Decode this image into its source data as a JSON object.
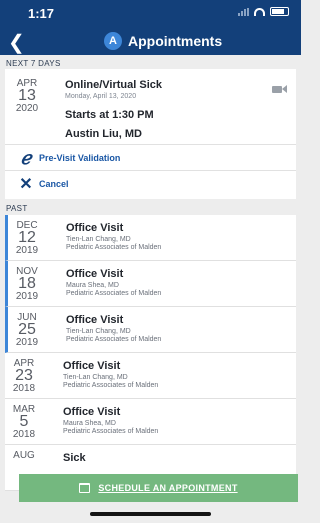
{
  "status_bar": {
    "time": "1:17"
  },
  "header": {
    "avatar_letter": "A",
    "title": "Appointments"
  },
  "sections": {
    "next_label": "NEXT 7 DAYS",
    "past_label": "PAST"
  },
  "upcoming": {
    "month": "APR",
    "day": "13",
    "year": "2020",
    "title": "Online/Virtual Sick",
    "subtitle": "Monday, April 13, 2020",
    "time": "Starts at 1:30 PM",
    "doctor": "Austin Liu, MD",
    "previsit_label": "Pre-Visit Validation",
    "cancel_label": "Cancel"
  },
  "past": [
    {
      "month": "DEC",
      "day": "12",
      "year": "2019",
      "title": "Office Visit",
      "doctor": "Tien-Lan Chang, MD",
      "practice": "Pediatric Associates of Malden"
    },
    {
      "month": "NOV",
      "day": "18",
      "year": "2019",
      "title": "Office Visit",
      "doctor": "Maura Shea, MD",
      "practice": "Pediatric Associates of Malden"
    },
    {
      "month": "JUN",
      "day": "25",
      "year": "2019",
      "title": "Office Visit",
      "doctor": "Tien-Lan Chang, MD",
      "practice": "Pediatric Associates of Malden"
    },
    {
      "month": "APR",
      "day": "23",
      "year": "2018",
      "title": "Office Visit",
      "doctor": "Tien-Lan Chang, MD",
      "practice": "Pediatric Associates of Malden"
    },
    {
      "month": "MAR",
      "day": "5",
      "year": "2018",
      "title": "Office Visit",
      "doctor": "Maura Shea, MD",
      "practice": "Pediatric Associates of Malden"
    },
    {
      "month": "AUG",
      "day": "",
      "year": "",
      "title": "Sick",
      "doctor": "",
      "practice": ""
    }
  ],
  "schedule_button": {
    "label": "SCHEDULE AN APPOINTMENT"
  },
  "colors": {
    "header": "#13407a",
    "accent": "#3d86d8",
    "cta": "#74b87f"
  }
}
